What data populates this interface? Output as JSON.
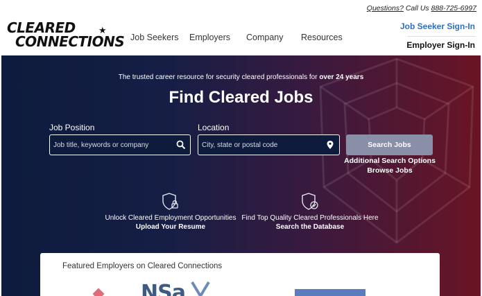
{
  "header": {
    "logo_line1": "Cleared",
    "logo_line2": "Connections",
    "nav": [
      "Job Seekers",
      "Employers",
      "Company",
      "Resources"
    ],
    "questions": "Questions?",
    "call_us": "Call Us",
    "phone": "888-725-6997",
    "job_seeker_signin": "Job Seeker Sign-In",
    "employer_signin": "Employer Sign-In"
  },
  "hero": {
    "tagline_prefix": "The trusted career resource for security cleared professionals for",
    "tagline_bold": "over 24 years",
    "title": "Find Cleared Jobs",
    "job_position_label": "Job Position",
    "job_position_placeholder": "Job title, keywords or company",
    "location_label": "Location",
    "location_placeholder": "City, state or postal code",
    "search_button": "Search Jobs",
    "additional_search": "Additional Search Options",
    "browse_jobs": "Browse Jobs"
  },
  "features": [
    {
      "text": "Unlock Cleared Employment Opportunities",
      "link": "Upload Your Resume",
      "icon": "shield-lock-icon"
    },
    {
      "text": "Find Top Quality Cleared Professionals Here",
      "link": "Search the Database",
      "icon": "shield-check-icon"
    }
  ],
  "featured": {
    "title": "Featured Employers on Cleared Connections",
    "logo_text": "NSa"
  },
  "colors": {
    "accent_blue": "#2f6fc2",
    "hero_left": "#0d1b3d",
    "hero_right": "#6a1424",
    "button": "#8a8fa8"
  }
}
